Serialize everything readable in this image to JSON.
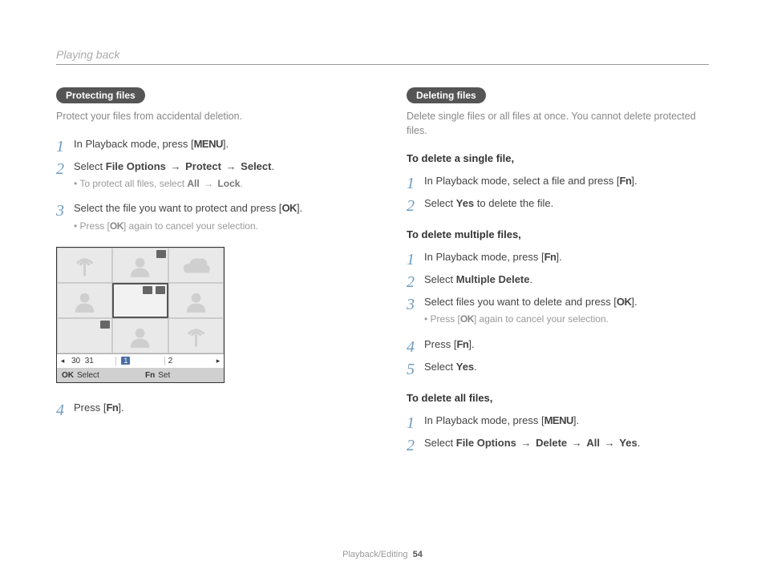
{
  "header": {
    "title": "Playing back"
  },
  "footer": {
    "section": "Playback/Editing",
    "page": "54"
  },
  "glyphs": {
    "menu": "MENU",
    "ok": "OK",
    "fn": "Fn",
    "arrow": "→"
  },
  "left": {
    "pill": "Protecting files",
    "intro": "Protect your files from accidental deletion.",
    "steps": {
      "s1": {
        "pre": "In Playback mode, press [",
        "post": "]."
      },
      "s2": {
        "pre": "Select ",
        "b1": "File Options",
        "b2": "Protect",
        "b3": "Select",
        "post": ".",
        "sub_pre": "To protect all files, select ",
        "sub_b1": "All",
        "sub_b2": "Lock",
        "sub_post": "."
      },
      "s3": {
        "text_pre": "Select the file you want to protect and press [",
        "text_post": "].",
        "sub_pre": "Press [",
        "sub_post": "] again to cancel your selection."
      },
      "s4": {
        "pre": "Press [",
        "post": "]."
      }
    },
    "fig": {
      "cal": {
        "d30": "30",
        "d31": "31",
        "m1": "1",
        "m2": "2"
      },
      "bar": {
        "l1": "Select",
        "l2": "Set"
      }
    }
  },
  "right": {
    "pill": "Deleting files",
    "intro": "Delete single files or all files at once. You cannot delete protected files.",
    "sec1": {
      "head": "To delete a single file,",
      "s1": {
        "pre": "In Playback mode, select a file and press [",
        "post": "]."
      },
      "s2": {
        "pre": "Select ",
        "b": "Yes",
        "post": " to delete the file."
      }
    },
    "sec2": {
      "head": "To delete multiple files,",
      "s1": {
        "pre": "In Playback mode, press [",
        "post": "]."
      },
      "s2": {
        "pre": "Select ",
        "b": "Multiple Delete",
        "post": "."
      },
      "s3": {
        "pre": "Select files you want to delete and press [",
        "post": "].",
        "sub_pre": "Press [",
        "sub_post": "] again to cancel your selection."
      },
      "s4": {
        "pre": "Press [",
        "post": "]."
      },
      "s5": {
        "pre": "Select ",
        "b": "Yes",
        "post": "."
      }
    },
    "sec3": {
      "head": "To delete all files,",
      "s1": {
        "pre": "In Playback mode, press [",
        "post": "]."
      },
      "s2": {
        "pre": "Select ",
        "b1": "File Options",
        "b2": "Delete",
        "b3": "All",
        "b4": "Yes",
        "post": "."
      }
    }
  }
}
